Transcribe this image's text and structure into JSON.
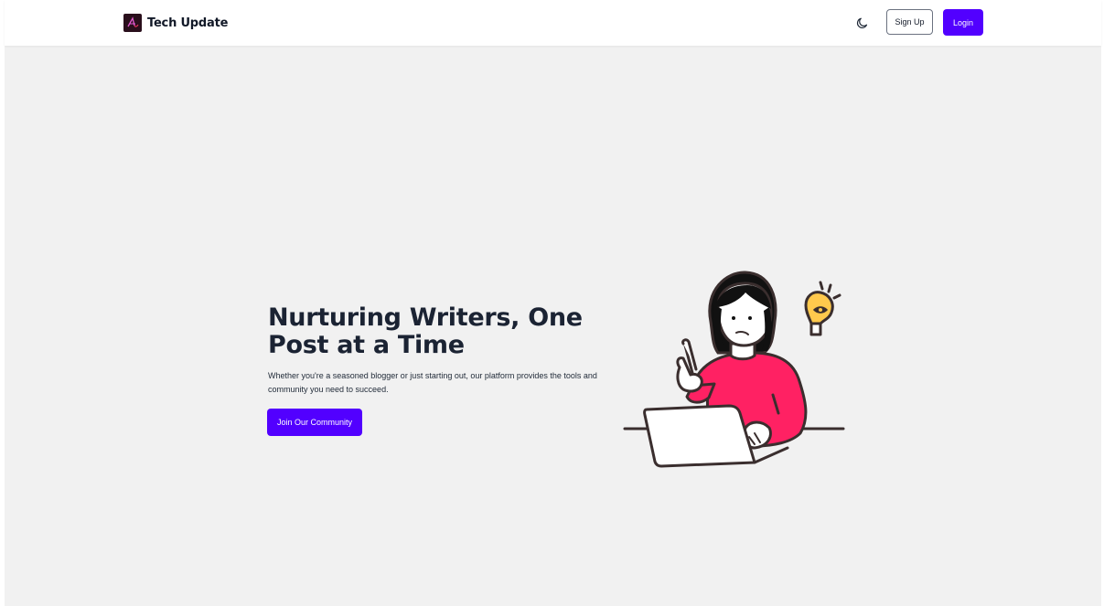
{
  "header": {
    "brand_name": "Tech Update",
    "theme_toggle_icon": "moon-icon",
    "signup_label": "Sign Up",
    "login_label": "Login"
  },
  "hero": {
    "title": "Nurturing Writers, One Post at a Time",
    "subtitle": "Whether you're a seasoned blogger or just starting out, our platform provides the tools and community you need to succeed.",
    "cta_label": "Join Our Community",
    "illustration_icon": "woman-at-laptop-with-idea-illustration"
  },
  "colors": {
    "accent": "#5200ff",
    "page_background": "#f1f1f1",
    "heading": "#1b2333",
    "illustration_sweater": "#ff2163",
    "illustration_bulb": "#ffc94d"
  }
}
